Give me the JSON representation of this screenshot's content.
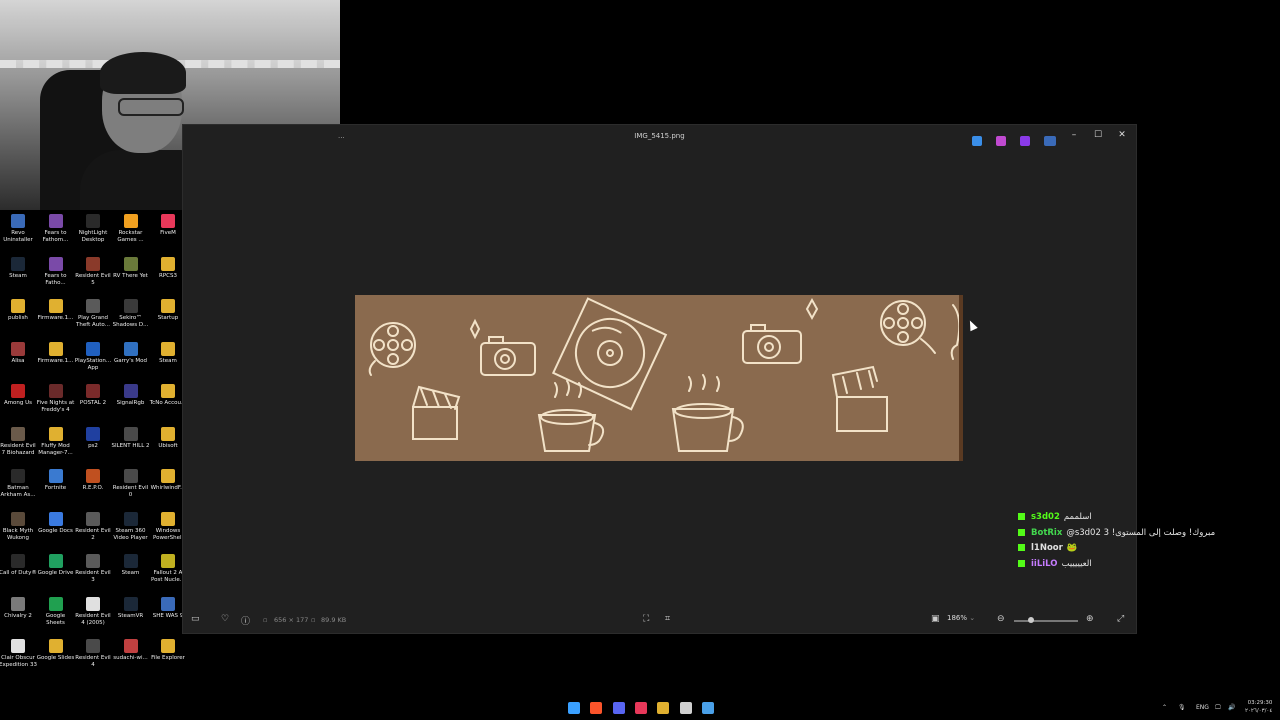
{
  "window": {
    "title": "IMG_5415.png",
    "menu_dots": "...",
    "controls": {
      "minimize": "–",
      "maximize": "☐",
      "close": "✕"
    },
    "toolbar_icons": [
      "edit-icon",
      "paint-icon",
      "designer-icon",
      "cloud-icon"
    ],
    "bottom": {
      "dimensions": "656 × 177",
      "file_size": "89.9 KB",
      "zoom": "186%"
    }
  },
  "desktop_icons": [
    {
      "label": "Revo Uninstaller",
      "color": "#3a6ab8"
    },
    {
      "label": "Fears to Fathom...",
      "color": "#7a4aa8"
    },
    {
      "label": "NightLight Desktop",
      "color": "#2a2a2a"
    },
    {
      "label": "Rockstar Games ...",
      "color": "#f0a020"
    },
    {
      "label": "FiveM",
      "color": "#e8385a"
    },
    {
      "label": "Steam",
      "color": "#1b2838"
    },
    {
      "label": "Fears to Fatho...",
      "color": "#7a4aa8"
    },
    {
      "label": "Resident Evil 5",
      "color": "#8a3a2a"
    },
    {
      "label": "RV There Yet",
      "color": "#6a7a3a"
    },
    {
      "label": "RPCS3",
      "color": "#e0b030"
    },
    {
      "label": "publish",
      "color": "#e0b030"
    },
    {
      "label": "Firmware.1...",
      "color": "#e0b030"
    },
    {
      "label": "Play Grand Theft Auto...",
      "color": "#5a5a5a"
    },
    {
      "label": "Sekiro™ Shadows D...",
      "color": "#3a3a3a"
    },
    {
      "label": "Startup",
      "color": "#e0b030"
    },
    {
      "label": "Alisa",
      "color": "#9a3a3a"
    },
    {
      "label": "Firmware.1...",
      "color": "#e0b030"
    },
    {
      "label": "PlayStation... App",
      "color": "#2060c0"
    },
    {
      "label": "Garry's Mod",
      "color": "#3070c0"
    },
    {
      "label": "Steam",
      "color": "#e0b030"
    },
    {
      "label": "Among Us",
      "color": "#c02020"
    },
    {
      "label": "Five Nights at Freddy's 4",
      "color": "#6a2a2a"
    },
    {
      "label": "POSTAL 2",
      "color": "#7a2a2a"
    },
    {
      "label": "SignalRgb",
      "color": "#3a3a8a"
    },
    {
      "label": "TcNo Accou...",
      "color": "#e0b030"
    },
    {
      "label": "Resident Evil 7 Biohazard",
      "color": "#6a5a4a"
    },
    {
      "label": "Fluffy Mod Manager-7...",
      "color": "#e0b030"
    },
    {
      "label": "ps2",
      "color": "#2040a0"
    },
    {
      "label": "SILENT HILL 2",
      "color": "#4a4a4a"
    },
    {
      "label": "Ubisoft",
      "color": "#e0b030"
    },
    {
      "label": "Batman Arkham As...",
      "color": "#2a2a2a"
    },
    {
      "label": "Fortnite",
      "color": "#3a7ad0"
    },
    {
      "label": "R.E.P.O.",
      "color": "#c05020"
    },
    {
      "label": "Resident Evil 0",
      "color": "#4a4a4a"
    },
    {
      "label": "WhirlwindF...",
      "color": "#e0b030"
    },
    {
      "label": "Black Myth Wukong",
      "color": "#5a4a3a"
    },
    {
      "label": "Google Docs",
      "color": "#3a7ae0"
    },
    {
      "label": "Resident Evil 2",
      "color": "#5a5a5a"
    },
    {
      "label": "Steam 360 Video Player",
      "color": "#1b2838"
    },
    {
      "label": "Windows PowerShell",
      "color": "#e0b030"
    },
    {
      "label": "Call of Duty®",
      "color": "#2a2a2a"
    },
    {
      "label": "Google Drive",
      "color": "#20a060"
    },
    {
      "label": "Resident Evil 3",
      "color": "#5a5a5a"
    },
    {
      "label": "Steam",
      "color": "#1b2838"
    },
    {
      "label": "Fallout 2 A Post Nucle...",
      "color": "#c0b020"
    },
    {
      "label": "Chivalry 2",
      "color": "#7a7a7a"
    },
    {
      "label": "Google Sheets",
      "color": "#20a050"
    },
    {
      "label": "Resident Evil 4 (2005)",
      "color": "#e0e0e0"
    },
    {
      "label": "SteamVR",
      "color": "#1b2838"
    },
    {
      "label": "SHE WAS 9",
      "color": "#3a6ab8"
    },
    {
      "label": "Clair Obscur Expedition 33",
      "color": "#e0e0e0"
    },
    {
      "label": "Google Slides",
      "color": "#e0b030"
    },
    {
      "label": "Resident Evil 4",
      "color": "#4a4a4a"
    },
    {
      "label": "sudachi-wi...",
      "color": "#c04040"
    },
    {
      "label": "File Explorer",
      "color": "#e0b030"
    }
  ],
  "chat": [
    {
      "name": "s3d02",
      "text": "اسلممم",
      "cls": "a"
    },
    {
      "name": "BotRix",
      "text": "@s3d02 3 !مبروك! وصلت إلى المستوى",
      "cls": "b"
    },
    {
      "name": "l1Noor",
      "text": "🐸",
      "cls": "c"
    },
    {
      "name": "iiLiLO",
      "text": "العيييييب",
      "cls": "d"
    }
  ],
  "taskbar": {
    "apps": [
      {
        "name": "windows-start-icon",
        "color": "#3aa0ff"
      },
      {
        "name": "brave-icon",
        "color": "#fb542b"
      },
      {
        "name": "discord-icon",
        "color": "#5865f2"
      },
      {
        "name": "affinity-icon",
        "color": "#e8385a"
      },
      {
        "name": "file-explorer-icon",
        "color": "#e0b030"
      },
      {
        "name": "chrome-icon",
        "color": "#d0d0d0"
      },
      {
        "name": "photos-icon",
        "color": "#4aa0e8"
      }
    ],
    "lang": "ENG",
    "time": "03:29:30",
    "date": "٢٠٢٦/٠٣/٠٤"
  }
}
